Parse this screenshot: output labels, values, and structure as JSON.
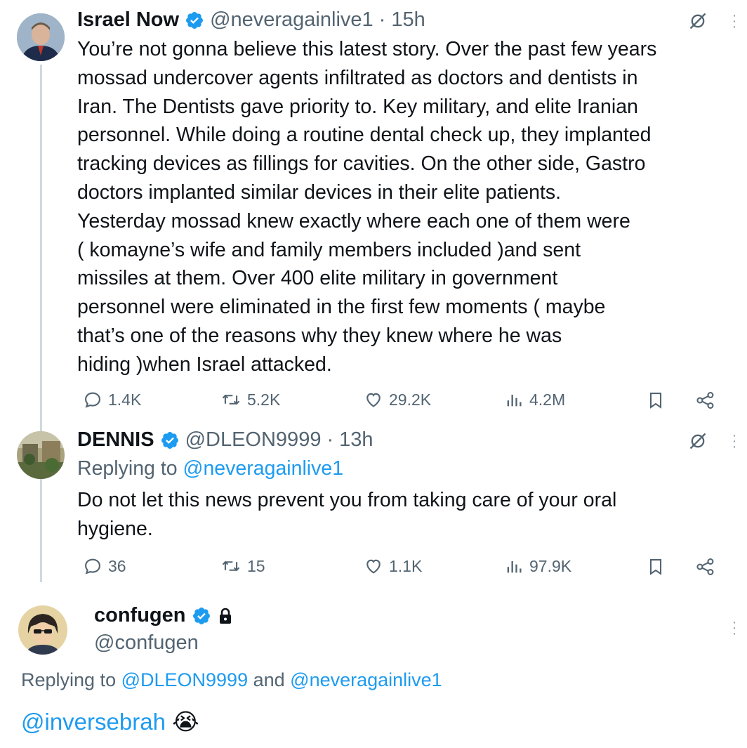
{
  "tweet1": {
    "name": "Israel Now",
    "handle": "@neveragainlive1",
    "time": "· 15h",
    "lines": [
      "You’re not gonna believe this latest story. Over the past few years",
      "mossad undercover agents infiltrated as doctors and dentists  in",
      "Iran. The Dentists gave priority to. Key military, and elite Iranian",
      "personnel. While doing a routine dental check up, they implanted",
      "tracking devices as fillings for cavities. On the other side, Gastro",
      "doctors implanted similar devices in their elite patients.",
      "Yesterday mossad knew exactly where each one of them were",
      "( komayne’s wife and family members included )and sent",
      "missiles at them. Over 400 elite military in government",
      "personnel were eliminated in the first few moments ( maybe",
      "that’s one of the reasons why they knew where he was",
      "hiding )when Israel attacked."
    ],
    "stats": {
      "replies": "1.4K",
      "reposts": "5.2K",
      "likes": "29.2K",
      "views": "4.2M"
    }
  },
  "tweet2": {
    "name": "DENNIS",
    "handle": "@DLEON9999",
    "time": "· 13h",
    "replying_prefix": "Replying to ",
    "replying_to": "@neveragainlive1",
    "lines": [
      "Do not let this news prevent you from taking care of your oral",
      "hygiene."
    ],
    "stats": {
      "replies": "36",
      "reposts": "15",
      "likes": "1.1K",
      "views": "97.9K"
    }
  },
  "tweet3": {
    "name": "confugen",
    "handle": "@confugen",
    "replying_prefix": "Replying to ",
    "replying_to_1": "@DLEON9999",
    "replying_and": " and ",
    "replying_to_2": "@neveragainlive1",
    "mention": "@inversebrah",
    "emoji": "😭"
  },
  "colors": {
    "text": "#0f1419",
    "secondary": "#536471",
    "link": "#1d9bf0",
    "verified": "#1d9bf0",
    "thread_line": "#cfd9de"
  },
  "icons": [
    "grok-icon",
    "more-icon",
    "reply-icon",
    "repost-icon",
    "like-icon",
    "views-icon",
    "bookmark-icon",
    "share-icon",
    "verified-icon",
    "lock-icon"
  ]
}
